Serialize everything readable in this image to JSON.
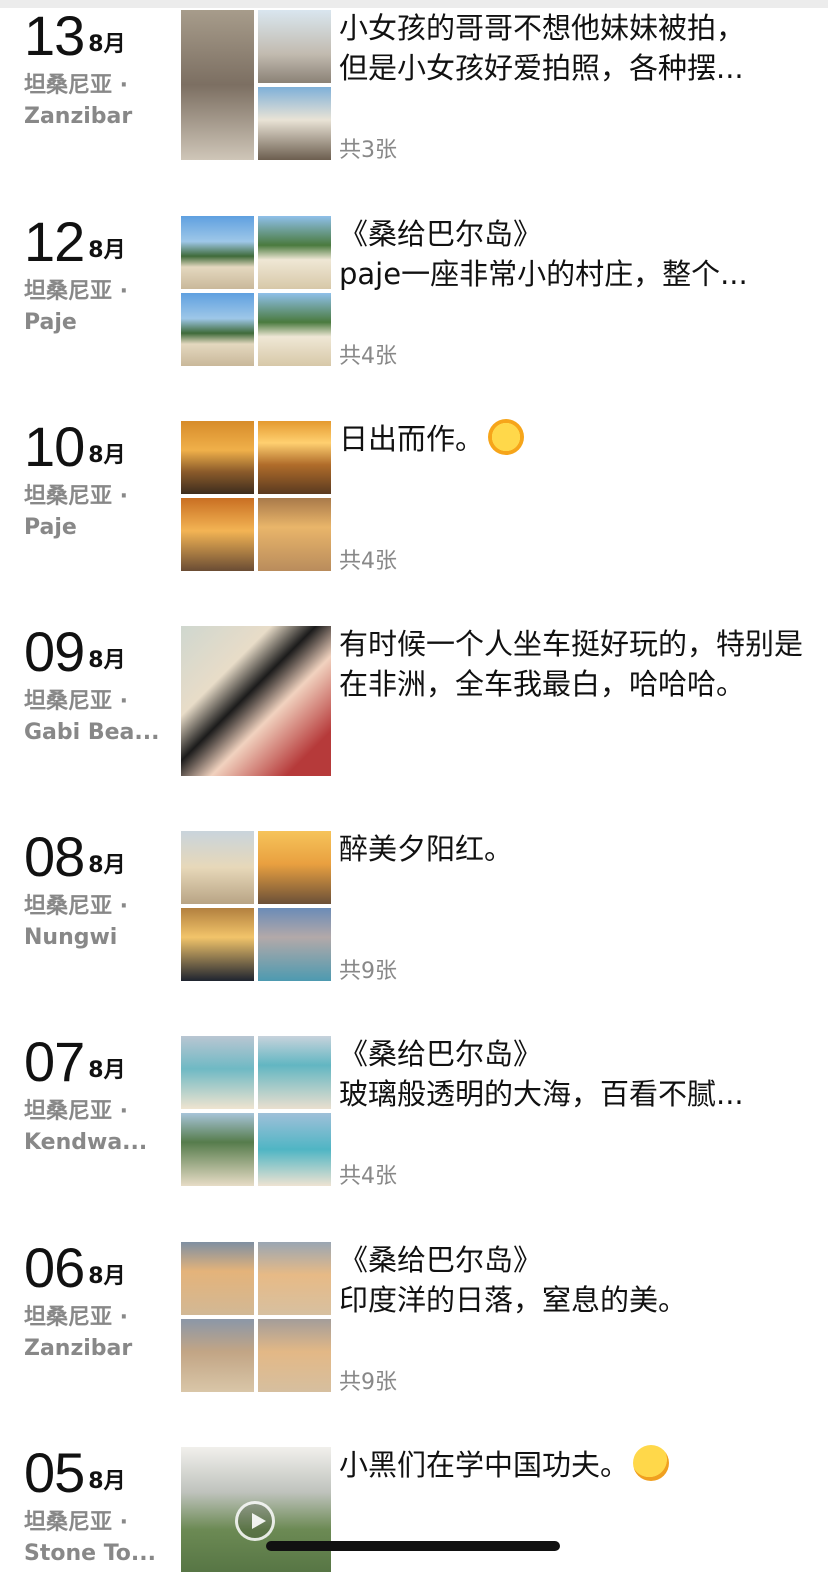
{
  "entries": [
    {
      "day": "13",
      "month": "8月",
      "country": "坦桑尼亚 ·",
      "place": "Zanzibar",
      "lines": [
        "小女孩的哥哥不想他妹妹被拍，",
        "但是小女孩好爱拍照，各种摆..."
      ],
      "count": "共3张",
      "photos": [
        "p-beach1",
        "p-beach2",
        "p-beach3"
      ]
    },
    {
      "day": "12",
      "month": "8月",
      "country": "坦桑尼亚 ·",
      "place": "Paje",
      "lines": [
        "《桑给巴尔岛》",
        "paje一座非常小的村庄，整个..."
      ],
      "count": "共4张",
      "photos": [
        "p-palm1",
        "p-palm2",
        "p-palm1",
        "p-palm2"
      ]
    },
    {
      "day": "10",
      "month": "8月",
      "country": "坦桑尼亚 ·",
      "place": "Paje",
      "lines": [
        "日出而作。"
      ],
      "emoji": "sun-emoji",
      "count": "共4张",
      "photos": [
        "p-sun1",
        "p-sun2",
        "p-sun3",
        "p-sun4"
      ]
    },
    {
      "day": "09",
      "month": "8月",
      "country": "坦桑尼亚 ·",
      "place": "Gabi Bea...",
      "text": "有时候一个人坐车挺好玩的，特别是在非洲，全车我最白，哈哈哈。",
      "photos": [
        "p-selfie"
      ]
    },
    {
      "day": "08",
      "month": "8月",
      "country": "坦桑尼亚 ·",
      "place": "Nungwi",
      "lines": [
        "醉美夕阳红。"
      ],
      "count": "共9张",
      "photos": [
        "p-sset1",
        "p-sset2",
        "p-sset3",
        "p-sset4"
      ]
    },
    {
      "day": "07",
      "month": "8月",
      "country": "坦桑尼亚 ·",
      "place": "Kendwa...",
      "lines": [
        "《桑给巴尔岛》",
        "玻璃般透明的大海，百看不腻..."
      ],
      "count": "共4张",
      "photos": [
        "p-sea1",
        "p-sea2",
        "p-sea3",
        "p-sea4"
      ]
    },
    {
      "day": "06",
      "month": "8月",
      "country": "坦桑尼亚 ·",
      "place": "Zanzibar",
      "lines": [
        "《桑给巴尔岛》",
        "印度洋的日落，窒息的美。"
      ],
      "count": "共9张",
      "photos": [
        "p-ev1",
        "p-ev2",
        "p-ev3",
        "p-ev4"
      ]
    },
    {
      "day": "05",
      "month": "8月",
      "country": "坦桑尼亚 ·",
      "place": "Stone To...",
      "lines": [
        "小黑们在学中国功夫。"
      ],
      "emoji": "thinking-emoji",
      "photos": [
        "p-kungfu"
      ],
      "video": true
    }
  ]
}
